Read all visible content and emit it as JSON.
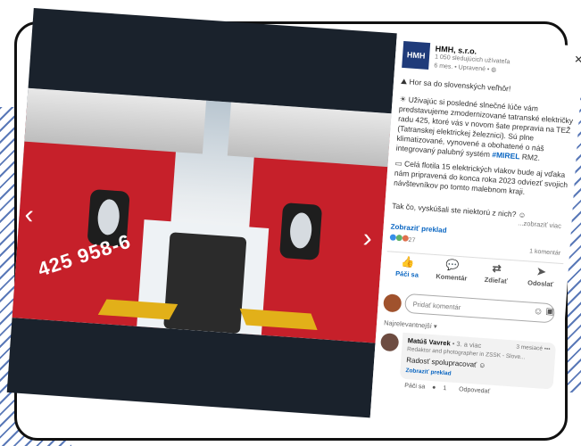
{
  "photo": {
    "train_number": "425 958-6",
    "prev_icon": "chevron-left-icon",
    "next_icon": "chevron-right-icon"
  },
  "post": {
    "company": "HMH, s.r.o.",
    "logo_text": "HMH",
    "followers": "1 050 sledujúcich užívateľa",
    "meta": "6 mes. • Upravené •",
    "line1": "Hor sa do slovenských veľhôr!",
    "para1": "Uživajúc si posledné slnečné lúče vám predstavujeme zmodernizované tatranské električky radu 425, ktoré vás v novom šate prepravia na TEŽ (Tatranskej elektrickej železnici). Sú plne klimatizované, vynovené a obohatené o náš integrovaný palubný systém",
    "hashtag": "#MIREL",
    "para1_end": "RM2.",
    "para2": "Celá flotila 15 elektrických vlakov bude aj vďaka nám pripravená do konca roka 2023 odviezť svojich návštevníkov po tomto malebnom kraji.",
    "question": "Tak čo, vyskúšali ste niektorú z nich?",
    "more": "...zobraziť viac",
    "translate": "Zobraziť preklad",
    "reactions_count": "27",
    "comments_count": "1 komentár",
    "actions": {
      "like": "Páči sa",
      "comment": "Komentár",
      "share": "Zdieľať",
      "send": "Odoslať"
    },
    "composer_placeholder": "Pridať komentár",
    "sort_label": "Najrelevantnejší ▾"
  },
  "comment": {
    "name": "Matúš Vavrek",
    "degree": "• 3. a viac",
    "time": "3 mesiacé •••",
    "role": "Redaktor and photographer in ZSSK - Slove...",
    "text": "Radosť spolupracovať",
    "translate": "Zobraziť preklad",
    "like": "Páči sa",
    "reactions": "1",
    "reply": "Odpovedať"
  },
  "colors": {
    "brand": "#1f3b7a",
    "link": "#0a66c2",
    "train_red": "#c6202a"
  }
}
